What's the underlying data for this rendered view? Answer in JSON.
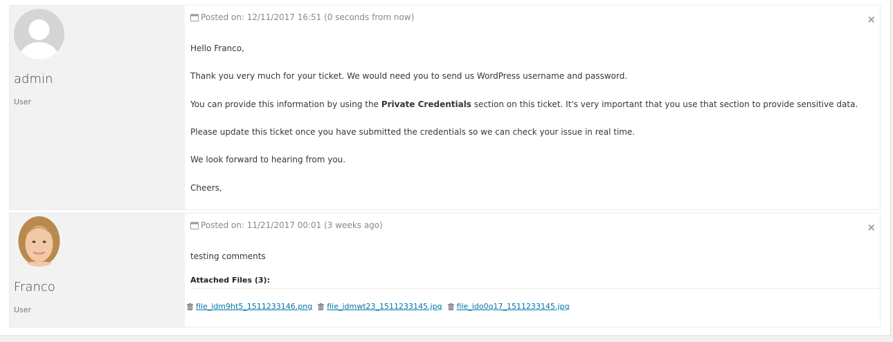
{
  "comments": [
    {
      "author": "admin",
      "role": "User",
      "avatar_icon": "default-user-avatar-icon",
      "posted": "Posted on: 12/11/2017 16:51 (0 seconds from now)",
      "greeting": "Hello Franco,",
      "p1": "Thank you very much for your ticket.  We would need you to send us WordPress username and password.",
      "p2_before": "You can provide this information by using the ",
      "p2_bold": "Private Credentials",
      "p2_after": " section on this ticket. It's very important that you use that section to provide sensitive data.",
      "p3": "Please update this ticket once you have submitted the credentials so we can check your issue in real time.",
      "p4": "We look forward to hearing from you.",
      "p5": "Cheers,",
      "close_label": "×"
    },
    {
      "author": "Franco",
      "role": "User",
      "avatar_icon": "user-photo-avatar",
      "posted": "Posted on: 11/21/2017 00:01 (3 weeks ago)",
      "text": "testing comments",
      "attached_label": "Attached Files (3):",
      "files": [
        "file_idm9ht5_1511233146.png",
        "file_idmwt23_1511233145.jpg",
        "file_ido0q17_1511233145.jpg"
      ],
      "close_label": "×"
    }
  ],
  "colors": {
    "link": "#0073aa",
    "muted": "#888888",
    "author_bg": "#f2f2f2"
  }
}
